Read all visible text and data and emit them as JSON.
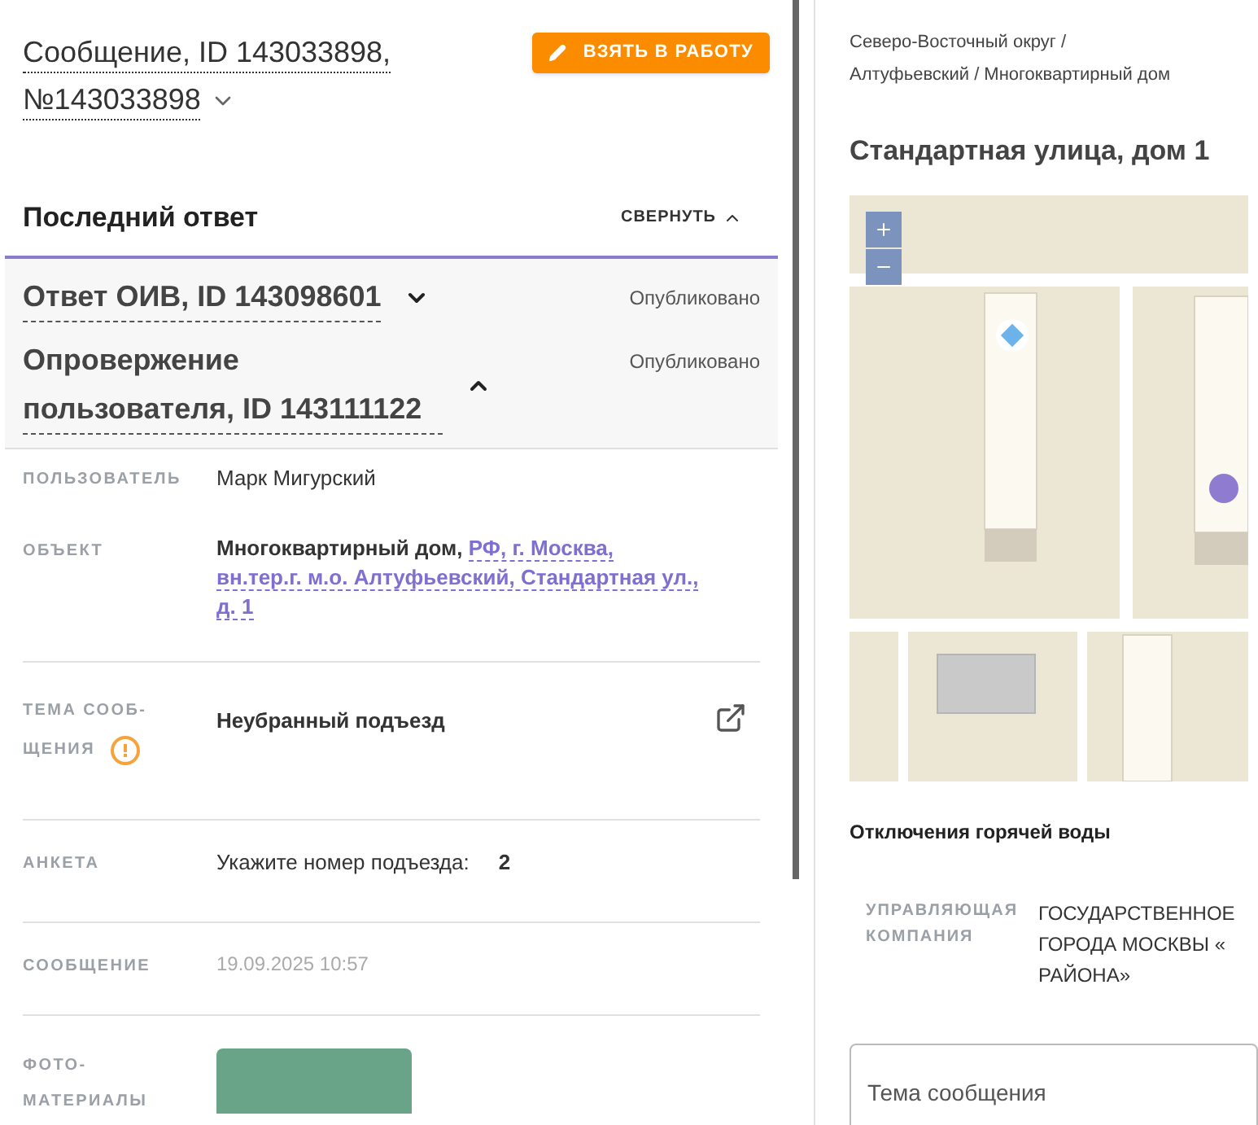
{
  "message": {
    "title": "Сообщение, ID 143033898,",
    "number": "№143033898"
  },
  "take_button": {
    "label": "ВЗЯТЬ В РАБОТУ"
  },
  "last_response": {
    "title": "Последний ответ",
    "collapse_label": "СВЕРНУТЬ",
    "items": [
      {
        "title": "Ответ ОИВ, ID 143098601",
        "status": "Опубликовано",
        "expanded": false
      },
      {
        "title": "Опровержение пользователя, ID 143111122",
        "status": "Опубликовано",
        "expanded": true
      }
    ]
  },
  "fields": [
    {
      "kind": "text",
      "label": "ПОЛЬЗОВАТЕЛЬ",
      "value": "Марк Мигурский"
    },
    {
      "kind": "object",
      "label": "ОБЪЕКТ",
      "value": "Многоквартирный дом,",
      "link_lines": [
        "РФ, г. Москва,",
        "вн.тер.г. м.о. Алтуфьевский, Стандартная ул.,",
        "д. 1"
      ]
    },
    {
      "kind": "topic",
      "label_lines": [
        "ТЕМА СООБ-",
        "ЩЕНИЯ"
      ],
      "value": "Неубранный подъезд",
      "warning": true
    },
    {
      "kind": "survey",
      "label": "АНКЕТА",
      "question": "Укажите номер подъезда:",
      "answer": "2"
    },
    {
      "kind": "date",
      "label": "СООБЩЕНИЕ",
      "value": "19.09.2025 10:57"
    },
    {
      "kind": "photo",
      "label": "ФОТО-МАТЕРИАЛЫ"
    }
  ],
  "breadcrumb": {
    "lines": [
      "Северо-Восточный округ /",
      "Алтуфьевский / Многоквартирный дом"
    ]
  },
  "address_title": "Стандартная улица, дом 1",
  "hot_water": "Отключения горячей воды",
  "company": {
    "label": "УПРАВЛЯЮЩАЯ КОМПАНИЯ",
    "lines": [
      "ГОСУДАРСТВЕННОЕ",
      "ГОРОДА МОСКВЫ «",
      "РАЙОНА»"
    ]
  },
  "topic_field": {
    "placeholder": "Тема сообщения"
  }
}
